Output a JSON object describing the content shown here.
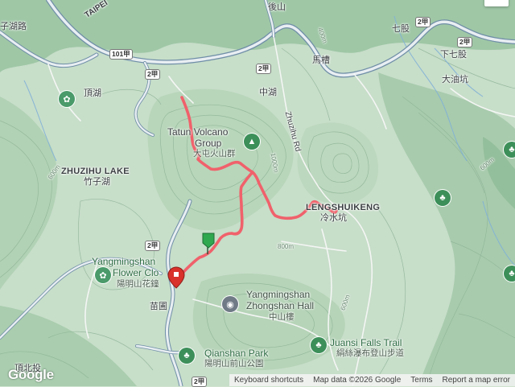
{
  "map": {
    "place_labels": {
      "zhuzihu_lake_en": "ZHUZIHU LAKE",
      "zhuzihu_lake_zh": "竹子湖",
      "tatun_line1": "Tatun Volcano",
      "tatun_line2": "Group",
      "tatun_zh": "大屯火山群",
      "lengshuikeng_en": "LENGSHUIKENG",
      "lengshuikeng_zh": "冷水坑",
      "dinghu": "頂湖",
      "zhonghu": "中湖",
      "houshan": "後山",
      "macao": "馬槽",
      "qigu": "七股",
      "xiaqigu": "下七股",
      "dayoukeng": "大油坑",
      "miaopu": "苗圃",
      "zhuzihu_road": "子湖路",
      "taipei_road": "TAIPEI",
      "zhuzihu_rd_label": "Zhuzihu Rd",
      "dingbeitou": "頂北投"
    },
    "poi_labels": {
      "flower_clock_line1": "Yangmingshan",
      "flower_clock_line2": "Flower Clo",
      "flower_clock_zh": "陽明山花鐘",
      "zhongshan_hall_line1": "Yangmingshan",
      "zhongshan_hall_line2": "Zhongshan Hall",
      "zhongshan_hall_zh": "中山樓",
      "qianshan_park_en": "Qianshan Park",
      "qianshan_park_zh": "陽明山前山公園",
      "juansi_falls_en": "Juansi Falls Trail",
      "juansi_falls_zh": "絹絲瀑布登山步道"
    },
    "road_badges": {
      "r101": "101甲",
      "r2jia_top": "2甲",
      "r2jia_left": "2甲",
      "r2jia_mid": "2甲",
      "r2jia_right": "2甲",
      "r2_left": "2甲",
      "r2_bottom": "2甲"
    },
    "contours": {
      "c600_1": "600m",
      "c600_2": "600m",
      "c800": "800m",
      "c1000": "1000m",
      "c800b": "800m",
      "c600_3": "600m",
      "c400": "400m",
      "c600_4": "600m"
    },
    "track_color": "#f0616b",
    "start_marker_color": "#2fa84f",
    "end_marker_color": "#d9312b"
  },
  "footer": {
    "logo": "Google",
    "keyboard_shortcuts": "Keyboard shortcuts",
    "map_data": "Map data ©2026 Google",
    "terms": "Terms",
    "report": "Report a map error"
  },
  "logo_colors": [
    "#4285F4",
    "#EA4335",
    "#FBBC05",
    "#4285F4",
    "#34A853",
    "#EA4335"
  ]
}
